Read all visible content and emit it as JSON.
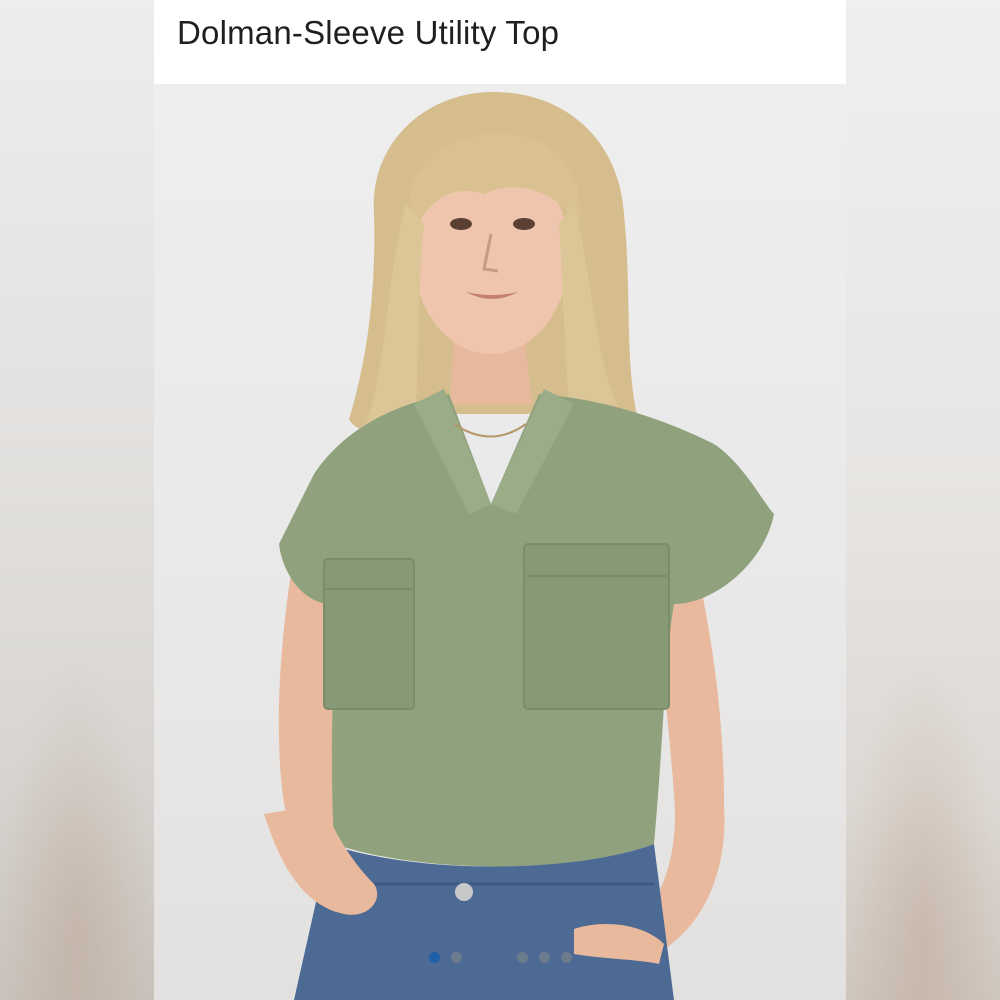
{
  "product": {
    "title": "Dolman-Sleeve Utility Top",
    "image_description_icon": "product-photo",
    "colors": {
      "shirt": "#8fa27d",
      "denim": "#4c6a94",
      "active_dot": "#1f5fa8"
    }
  },
  "carousel": {
    "total": 7,
    "active_index": 0
  }
}
